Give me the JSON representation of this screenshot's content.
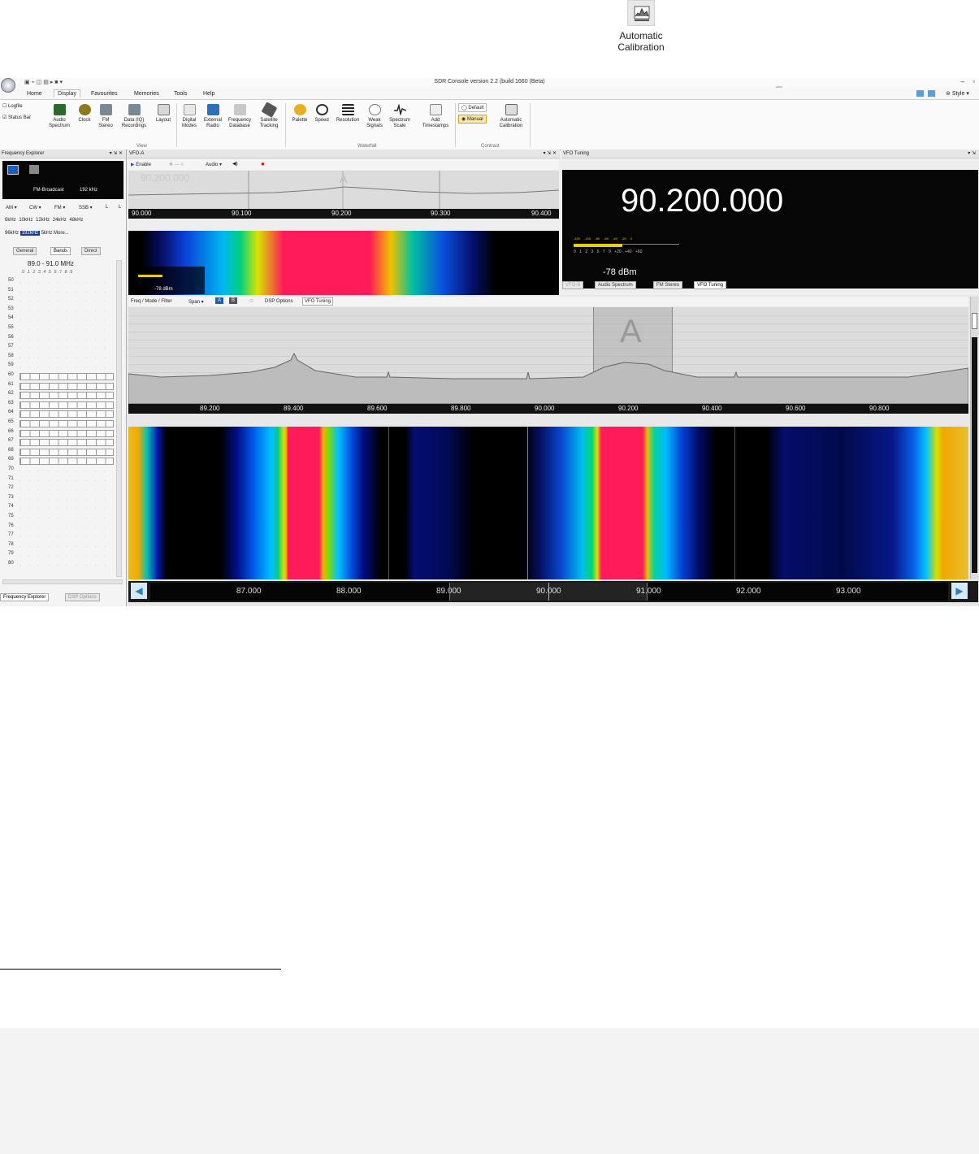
{
  "floating_button": {
    "label_line1": "Automatic",
    "label_line2": "Calibration",
    "icon": "automatic-calibration-icon"
  },
  "window": {
    "title": "SDR Console version 2.2 (build 1660 (Beta)",
    "style_label": "Style"
  },
  "menu": [
    "Home",
    "Display",
    "Favourites",
    "Memories",
    "Tools",
    "Help"
  ],
  "ribbon": {
    "checks": [
      "Logfile",
      "Status Bar"
    ],
    "view_buttons": [
      {
        "l1": "Audio",
        "l2": "Spectrum"
      },
      {
        "l1": "Clock",
        "l2": ""
      },
      {
        "l1": "FM",
        "l2": "Stereo"
      },
      {
        "l1": "Data (IQ)",
        "l2": "Recordings"
      },
      {
        "l1": "Layout",
        "l2": ""
      },
      {
        "l1": "Digital",
        "l2": "Modes"
      },
      {
        "l1": "External",
        "l2": "Radio"
      },
      {
        "l1": "Frequency",
        "l2": "Database"
      },
      {
        "l1": "Satellite",
        "l2": "Tracking"
      }
    ],
    "waterfall_buttons": [
      {
        "l1": "Palette",
        "l2": ""
      },
      {
        "l1": "Speed",
        "l2": ""
      },
      {
        "l1": "Resolution",
        "l2": ""
      },
      {
        "l1": "Weak",
        "l2": "Signals"
      },
      {
        "l1": "Spectrum",
        "l2": "Scale"
      },
      {
        "l1": "Add",
        "l2": "Timestamps"
      }
    ],
    "contrast": {
      "default": "Default",
      "manual": "Manual",
      "auto_l1": "Automatic",
      "auto_l2": "Calibration"
    },
    "groups": [
      "View",
      "Waterfall",
      "Contrast"
    ]
  },
  "freq_explorer": {
    "title": "Frequency Explorer",
    "preset": "FM-Broadcast",
    "preset_bw": "192 kHz",
    "modes": [
      "AM",
      "CW",
      "FM",
      "SSB",
      "L",
      "L"
    ],
    "bandwidths": [
      "6kHz",
      "10kHz",
      "12kHz",
      "24kHz",
      "48kHz"
    ],
    "bandwidths2": [
      "96kHz",
      "192kHz",
      "5kHz",
      "More..."
    ],
    "tabs": [
      "General",
      "Bands",
      "Direct"
    ],
    "range": "89.0 - 91.0 MHz",
    "decimals": ".0 .1 .2 .3 .4 .5 .6 .7 .8 .9",
    "rows": [
      "50",
      "51",
      "52",
      "53",
      "54",
      "55",
      "56",
      "57",
      "58",
      "59",
      "60",
      "61",
      "62",
      "63",
      "64",
      "65",
      "66",
      "67",
      "68",
      "69",
      "70",
      "71",
      "72",
      "73",
      "74",
      "75",
      "76",
      "77",
      "78",
      "79",
      "80"
    ],
    "bottom_tabs": [
      "Frequency Explorer",
      "DSP Options"
    ]
  },
  "vfo_panel": {
    "title": "VFO-A",
    "enable": "Enable",
    "audio": "Audio",
    "ghost_freq": "90.200.000",
    "scale": [
      "90.000",
      "90.100",
      "90.200",
      "90.300",
      "90.400"
    ],
    "meter": "-78 dBm"
  },
  "vfo_tuning": {
    "title": "VFO Tuning",
    "frequency": "90.200.000",
    "meter_top": [
      "-120",
      "-100",
      "-80",
      "-60",
      "-40",
      "-20",
      "0"
    ],
    "meter_bottom": [
      "0",
      "1",
      "2",
      "3",
      "5",
      "7",
      "9",
      "+20",
      "+40",
      "+60"
    ],
    "level": "-78 dBm",
    "tabs": [
      "VFO-B",
      "Audio Spectrum",
      "FM Stereo",
      "VFO Tuning"
    ]
  },
  "main_spectrum": {
    "toolbar": [
      "Freq / Mode / Filter",
      "Span",
      "A",
      "B",
      "DSP Options",
      "VFO Tuning"
    ],
    "vfo_marker": "A",
    "scale": [
      "89.200",
      "89.400",
      "89.600",
      "89.800",
      "90.000",
      "90.200",
      "90.400",
      "90.600",
      "90.800"
    ],
    "bottom_scale": [
      "87.000",
      "88.000",
      "89.000",
      "90.000",
      "91.000",
      "92.000",
      "93.000"
    ]
  }
}
